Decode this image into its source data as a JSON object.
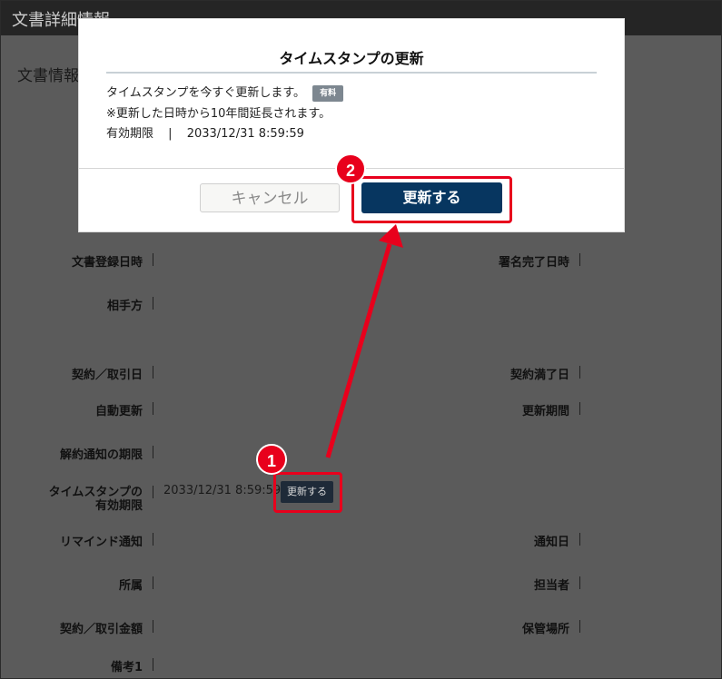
{
  "window": {
    "title": "文書詳細情報"
  },
  "background": {
    "heading": "文書情報",
    "fields_left": [
      {
        "label": "文書登録日時"
      },
      {
        "label": "相手方"
      },
      {
        "label": "契約／取引日"
      },
      {
        "label": "自動更新"
      },
      {
        "label": "解約通知の期限"
      },
      {
        "label_line1": "タイムスタンプの",
        "label_line2": "有効期限",
        "value": "2033/12/31 8:59:59"
      },
      {
        "label": "リマインド通知"
      },
      {
        "label": "所属"
      },
      {
        "label": "契約／取引金額"
      },
      {
        "label": "備考1"
      }
    ],
    "fields_right": [
      {
        "label": "署名完了日時"
      },
      {
        "label": "契約満了日"
      },
      {
        "label": "更新期間"
      },
      {
        "label": "通知日"
      },
      {
        "label": "担当者"
      },
      {
        "label": "保管場所"
      }
    ],
    "timestamp_update_button": "更新する"
  },
  "modal": {
    "title": "タイムスタンプの更新",
    "message": "タイムスタンプを今すぐ更新します。",
    "paid_badge": "有料",
    "note": "※更新した日時から10年間延長されます。",
    "expiry_label": "有効期限",
    "expiry_separator": "|",
    "expiry_value": "2033/12/31 8:59:59",
    "cancel_label": "キャンセル",
    "update_label": "更新する"
  },
  "annotations": {
    "step1": "1",
    "step2": "2",
    "highlight_color": "#e8001c"
  }
}
